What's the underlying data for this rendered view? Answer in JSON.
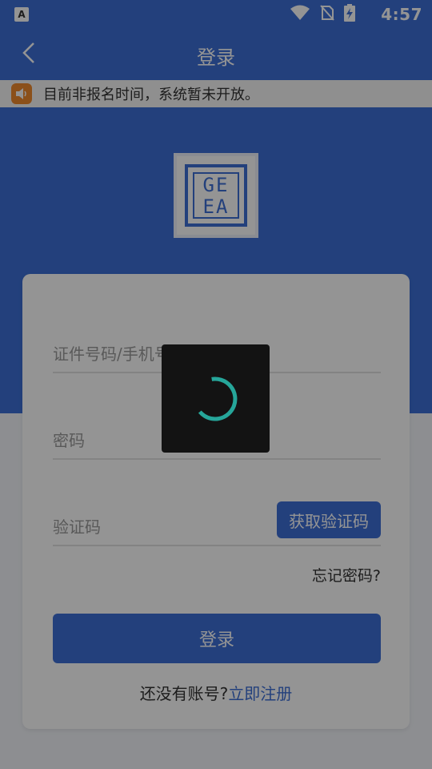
{
  "status_bar": {
    "time": "4:57",
    "app_badge": "A",
    "icons": [
      "wifi-icon",
      "no-sim-icon",
      "battery-charging-icon"
    ]
  },
  "nav": {
    "back_icon": "chevron-left-icon",
    "title": "登录"
  },
  "notice": {
    "icon": "speaker-icon",
    "text": "目前非报名时间，系统暂未开放。"
  },
  "logo": {
    "text_line1": "GE",
    "text_line2": "EA"
  },
  "form": {
    "id_placeholder": "证件号码/手机号",
    "password_placeholder": "密码",
    "code_placeholder": "验证码",
    "get_code_label": "获取验证码",
    "forgot_label": "忘记密码?",
    "login_label": "登录",
    "no_account_text": "还没有账号?",
    "register_link": "立即注册"
  },
  "loading": {
    "visible": true
  },
  "colors": {
    "primary": "#3d6fd6",
    "notice_icon": "#f08a2e",
    "spinner": "#26a69a"
  }
}
